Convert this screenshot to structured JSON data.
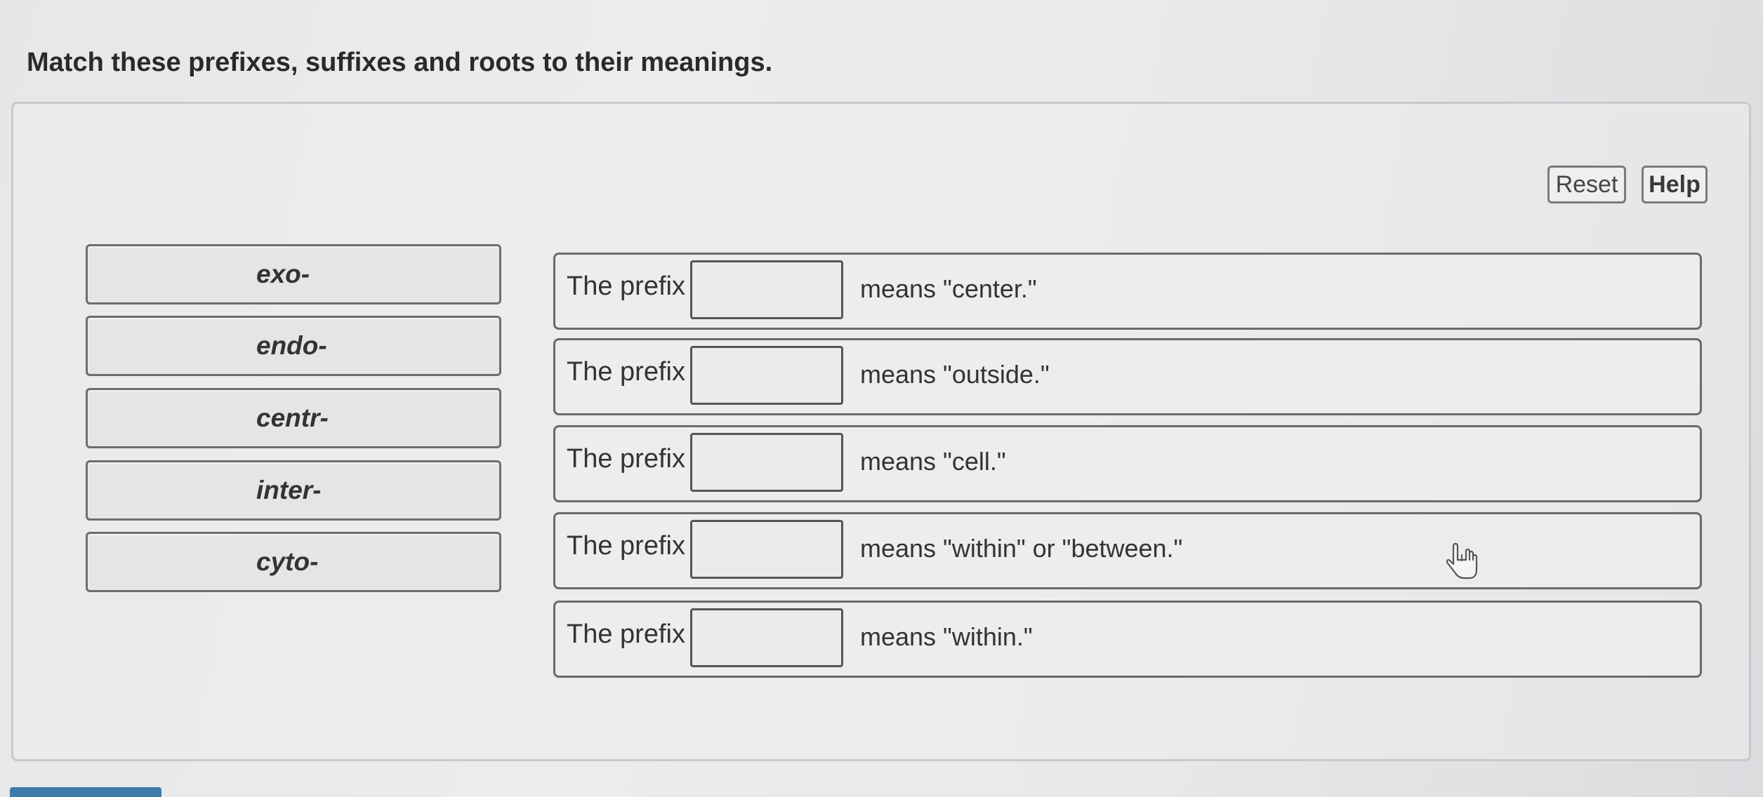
{
  "instructions": "Match these prefixes, suffixes and roots to their meanings.",
  "toolbar": {
    "reset_label": "Reset",
    "help_label": "Help"
  },
  "tiles": [
    {
      "label": "exo-"
    },
    {
      "label": "endo-"
    },
    {
      "label": "centr-"
    },
    {
      "label": "inter-"
    },
    {
      "label": "cyto-"
    }
  ],
  "statements": [
    {
      "prefix_text": "The prefix",
      "meaning": "means \"center.\""
    },
    {
      "prefix_text": "The prefix",
      "meaning": "means \"outside.\""
    },
    {
      "prefix_text": "The prefix",
      "meaning": "means \"cell.\""
    },
    {
      "prefix_text": "The prefix",
      "meaning": "means \"within\" or \"between.\""
    },
    {
      "prefix_text": "The prefix",
      "meaning": "means \"within.\""
    }
  ],
  "icons": {
    "cursor": "hand-pointer-icon"
  }
}
